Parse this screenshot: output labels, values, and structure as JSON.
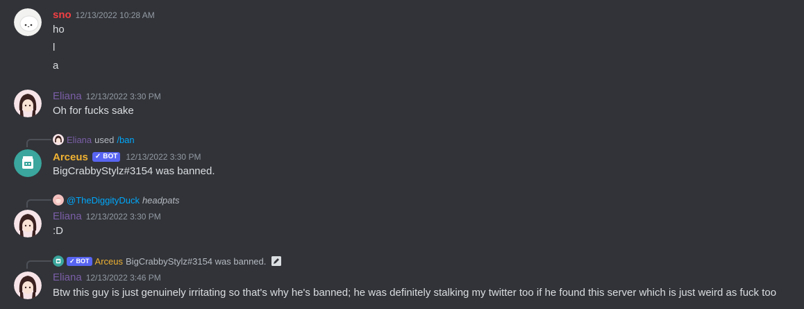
{
  "messages": [
    {
      "author": "sno",
      "timestamp": "12/13/2022 10:28 AM",
      "lines": [
        "ho",
        "l",
        "a"
      ]
    },
    {
      "author": "Eliana",
      "timestamp": "12/13/2022 3:30 PM",
      "lines": [
        "Oh for fucks sake"
      ]
    },
    {
      "reply": {
        "name": "Eliana",
        "used": "used",
        "command": "/ban"
      },
      "author": "Arceus",
      "bot_tag": "BOT",
      "timestamp": "12/13/2022 3:30 PM",
      "lines": [
        "BigCrabbyStylz#3154 was banned."
      ]
    },
    {
      "reply": {
        "mention": "@TheDiggityDuck",
        "text": "headpats"
      },
      "author": "Eliana",
      "timestamp": "12/13/2022 3:30 PM",
      "lines": [
        ":D"
      ]
    },
    {
      "reply": {
        "bot_tag": "BOT",
        "name": "Arceus",
        "text": "BigCrabbyStylz#3154 was banned."
      },
      "author": "Eliana",
      "timestamp": "12/13/2022 3:46 PM",
      "lines": [
        "Btw this guy is just genuinely irritating so that's why he's banned; he was definitely stalking my twitter too if he found this server which is just weird as fuck too"
      ]
    }
  ],
  "colors": {
    "background": "#313338",
    "sno_name": "#f23f43",
    "eliana_name": "#7b5ea7",
    "arceus_name": "#f0b232",
    "bot_badge": "#5865f2",
    "link": "#00a8fc"
  },
  "icons": {
    "bot_check": "check-icon",
    "edit": "edit-icon"
  }
}
